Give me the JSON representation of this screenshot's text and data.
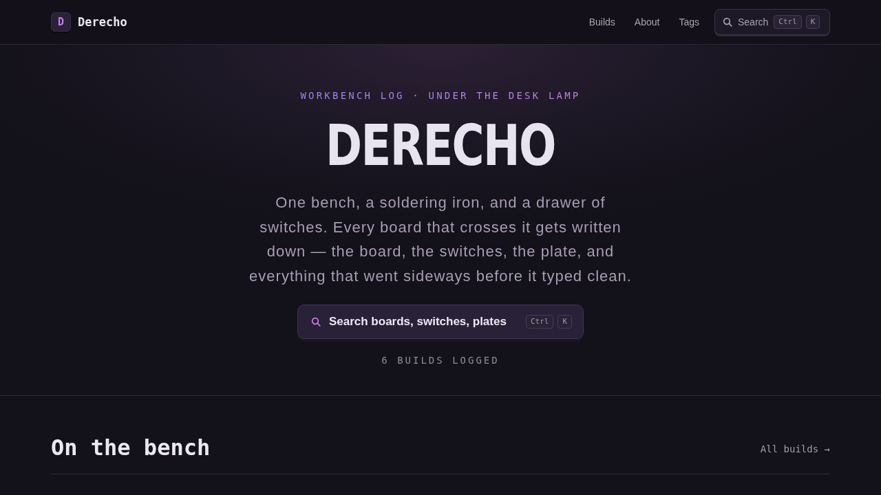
{
  "header": {
    "logo_mark": "D",
    "site_name": "Derecho",
    "nav": [
      {
        "label": "Builds"
      },
      {
        "label": "About"
      },
      {
        "label": "Tags"
      }
    ],
    "search": {
      "label": "Search",
      "keys": [
        "Ctrl",
        "K"
      ]
    }
  },
  "hero": {
    "eyebrow": "WORKBENCH LOG · UNDER THE DESK LAMP",
    "title": "DERECHO",
    "description": "One bench, a soldering iron, and a drawer of switches. Every board that crosses it gets written down — the board, the switches, the plate, and everything that went sideways before it typed clean.",
    "search": {
      "placeholder": "Search boards, switches, plates",
      "keys": [
        "Ctrl",
        "K"
      ]
    },
    "count": "6 BUILDS LOGGED"
  },
  "section": {
    "title": "On the bench",
    "link": "All builds →"
  }
}
